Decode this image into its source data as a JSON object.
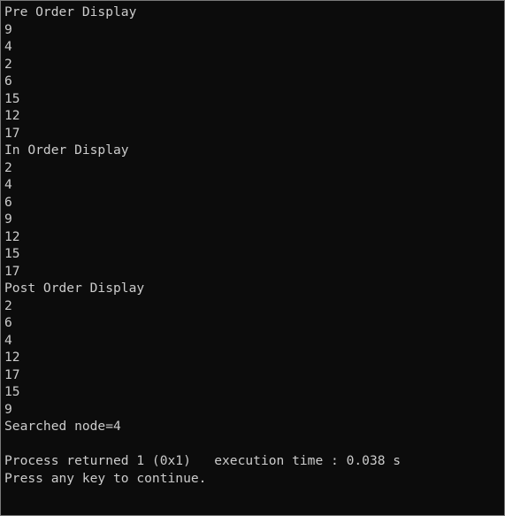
{
  "console": {
    "lines": [
      "Pre Order Display",
      "9",
      "4",
      "2",
      "6",
      "15",
      "12",
      "17",
      "In Order Display",
      "2",
      "4",
      "6",
      "9",
      "12",
      "15",
      "17",
      "Post Order Display",
      "2",
      "6",
      "4",
      "12",
      "17",
      "15",
      "9",
      "Searched node=4",
      "",
      "Process returned 1 (0x1)   execution time : 0.038 s",
      "Press any key to continue."
    ]
  }
}
